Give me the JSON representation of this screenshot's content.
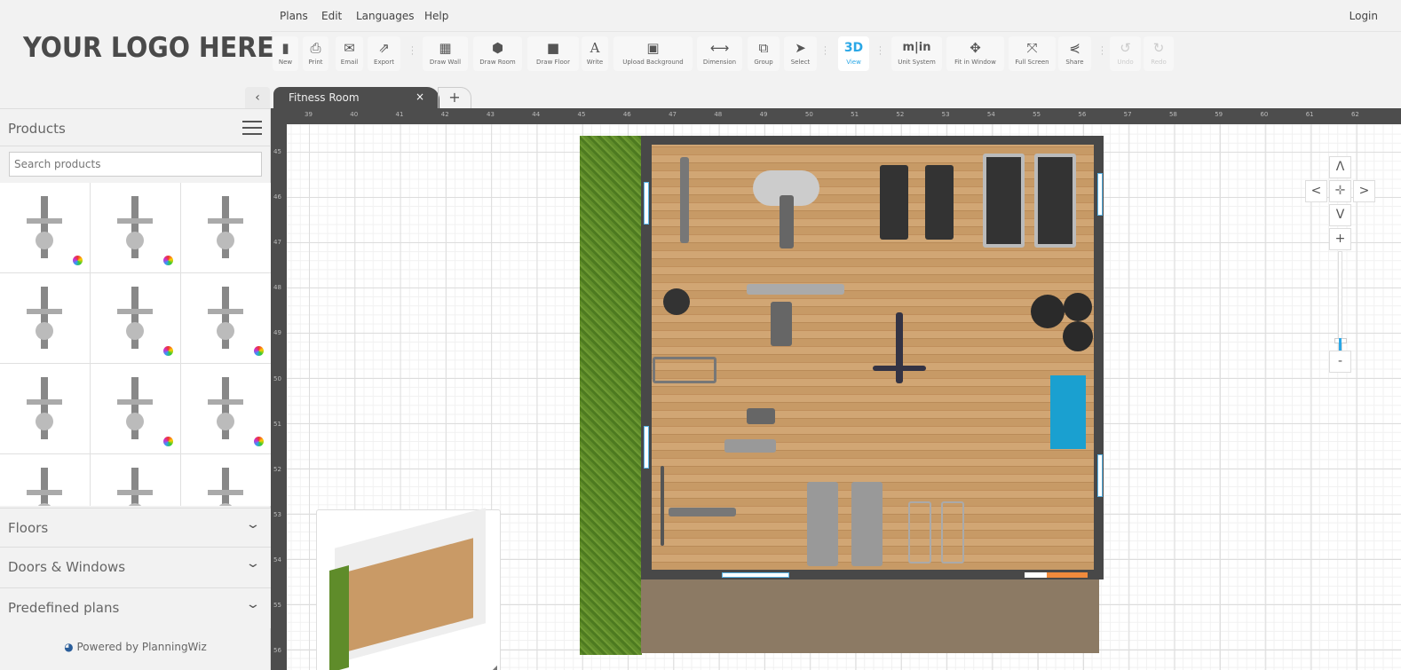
{
  "logo": "YOUR LOGO HERE",
  "menu": [
    "Plans",
    "Edit",
    "Languages",
    "Help"
  ],
  "login": "Login",
  "toolbar": [
    {
      "label": "New",
      "icon": "file-icon",
      "glyph": "▮"
    },
    {
      "label": "Print",
      "icon": "printer-icon",
      "glyph": "⎙"
    },
    {
      "label": "Email",
      "icon": "envelope-icon",
      "glyph": "✉"
    },
    {
      "label": "Export",
      "icon": "export-icon",
      "glyph": "⇗"
    },
    {
      "label": "Draw Wall",
      "icon": "brick-wall-icon",
      "glyph": "▦"
    },
    {
      "label": "Draw Room",
      "icon": "cube-icon",
      "glyph": "⬢"
    },
    {
      "label": "Draw Floor",
      "icon": "floor-square-icon",
      "glyph": "■"
    },
    {
      "label": "Write",
      "icon": "text-icon",
      "glyph": "A"
    },
    {
      "label": "Upload Background",
      "icon": "image-icon",
      "glyph": "▣"
    },
    {
      "label": "Dimension",
      "icon": "dimension-arrows-icon",
      "glyph": "⟷"
    },
    {
      "label": "Group",
      "icon": "group-icon",
      "glyph": "⧉"
    },
    {
      "label": "Select",
      "icon": "cursor-icon",
      "glyph": "➤"
    },
    {
      "label": "View",
      "icon": "3d-icon",
      "glyph": "3D"
    },
    {
      "label": "Unit System",
      "icon": "unit-system-icon",
      "glyph": "m|in"
    },
    {
      "label": "Fit in Window",
      "icon": "move-arrows-icon",
      "glyph": "✥"
    },
    {
      "label": "Full Screen",
      "icon": "fullscreen-icon",
      "glyph": "⤧"
    },
    {
      "label": "Share",
      "icon": "share-icon",
      "glyph": "⋞"
    },
    {
      "label": "Undo",
      "icon": "undo-icon",
      "glyph": "↺"
    },
    {
      "label": "Redo",
      "icon": "redo-icon",
      "glyph": "↻"
    }
  ],
  "sidebar": {
    "collapse": "‹",
    "products_title": "Products",
    "search_placeholder": "Search products",
    "sections": [
      "Floors",
      "Doors & Windows",
      "Predefined plans"
    ],
    "powered_by": "Powered by PlanningWiz"
  },
  "tabs": {
    "active": "Fitness Room",
    "close": "×",
    "add": "+"
  },
  "rulers": {
    "x": [
      "39",
      "40",
      "41",
      "42",
      "43",
      "44",
      "45",
      "46",
      "47",
      "48",
      "49",
      "50",
      "51",
      "52",
      "53",
      "54",
      "55",
      "56",
      "57",
      "58",
      "59",
      "60",
      "61",
      "62"
    ],
    "y": [
      "45",
      "46",
      "47",
      "48",
      "49",
      "50",
      "51",
      "52",
      "53",
      "54",
      "55",
      "56"
    ]
  },
  "nav": {
    "up": "Λ",
    "down": "V",
    "left": "<",
    "right": ">",
    "zoom_in": "+",
    "zoom_out": "-",
    "zoom_level": 0.05
  },
  "colors": {
    "accent": "#2aa7e6",
    "ruler": "#4d4d4d",
    "wall": "#484848"
  }
}
